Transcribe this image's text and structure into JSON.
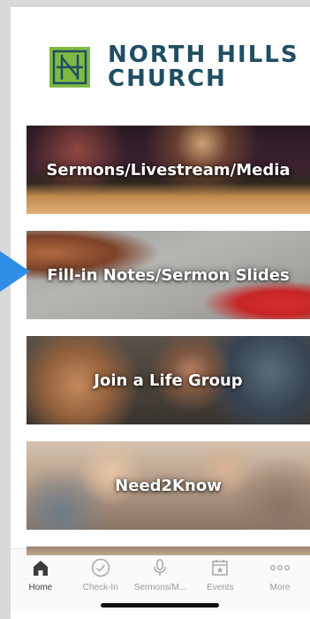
{
  "logo": {
    "line1": "NORTH HILLS",
    "line2": "CHURCH",
    "mark_color": "#7fb843",
    "text_color": "#1f4e62"
  },
  "tiles": [
    {
      "label": "Sermons/Livestream/Media"
    },
    {
      "label": "Fill-in Notes/Sermon Slides"
    },
    {
      "label": "Join a Life Group"
    },
    {
      "label": "Need2Know"
    }
  ],
  "pointer_arrow": {
    "color": "#2f8fe6"
  },
  "tabbar": {
    "items": [
      {
        "label": "Home",
        "icon": "house-icon"
      },
      {
        "label": "Check-In",
        "icon": "check-circle-icon"
      },
      {
        "label": "Sermons/M...",
        "icon": "microphone-icon"
      },
      {
        "label": "Events",
        "icon": "calendar-star-icon"
      },
      {
        "label": "More",
        "icon": "more-dots-icon"
      }
    ]
  }
}
